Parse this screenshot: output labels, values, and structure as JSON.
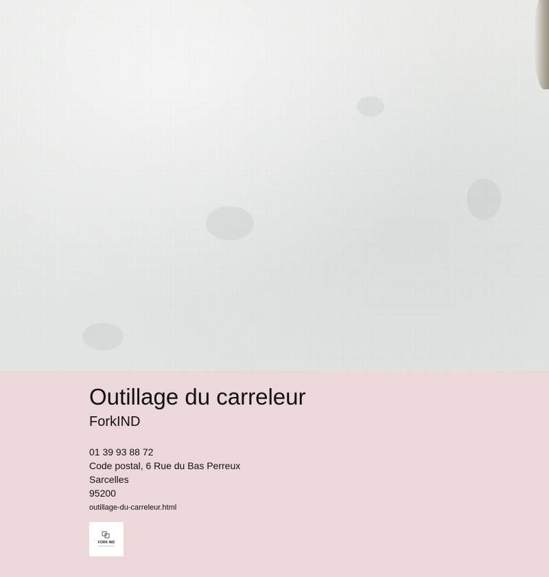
{
  "hero": {
    "image": "white-wall-texture"
  },
  "business": {
    "title": "Outillage du carreleur",
    "name": "ForkIND",
    "phone": "01 39 93 88 72",
    "address": "Code postal, 6 Rue du Bas Perreux",
    "city": "Sarcelles",
    "postal_code": "95200",
    "file": "outillage-du-carreleur.html"
  },
  "logo": {
    "text": "FORK IND"
  }
}
